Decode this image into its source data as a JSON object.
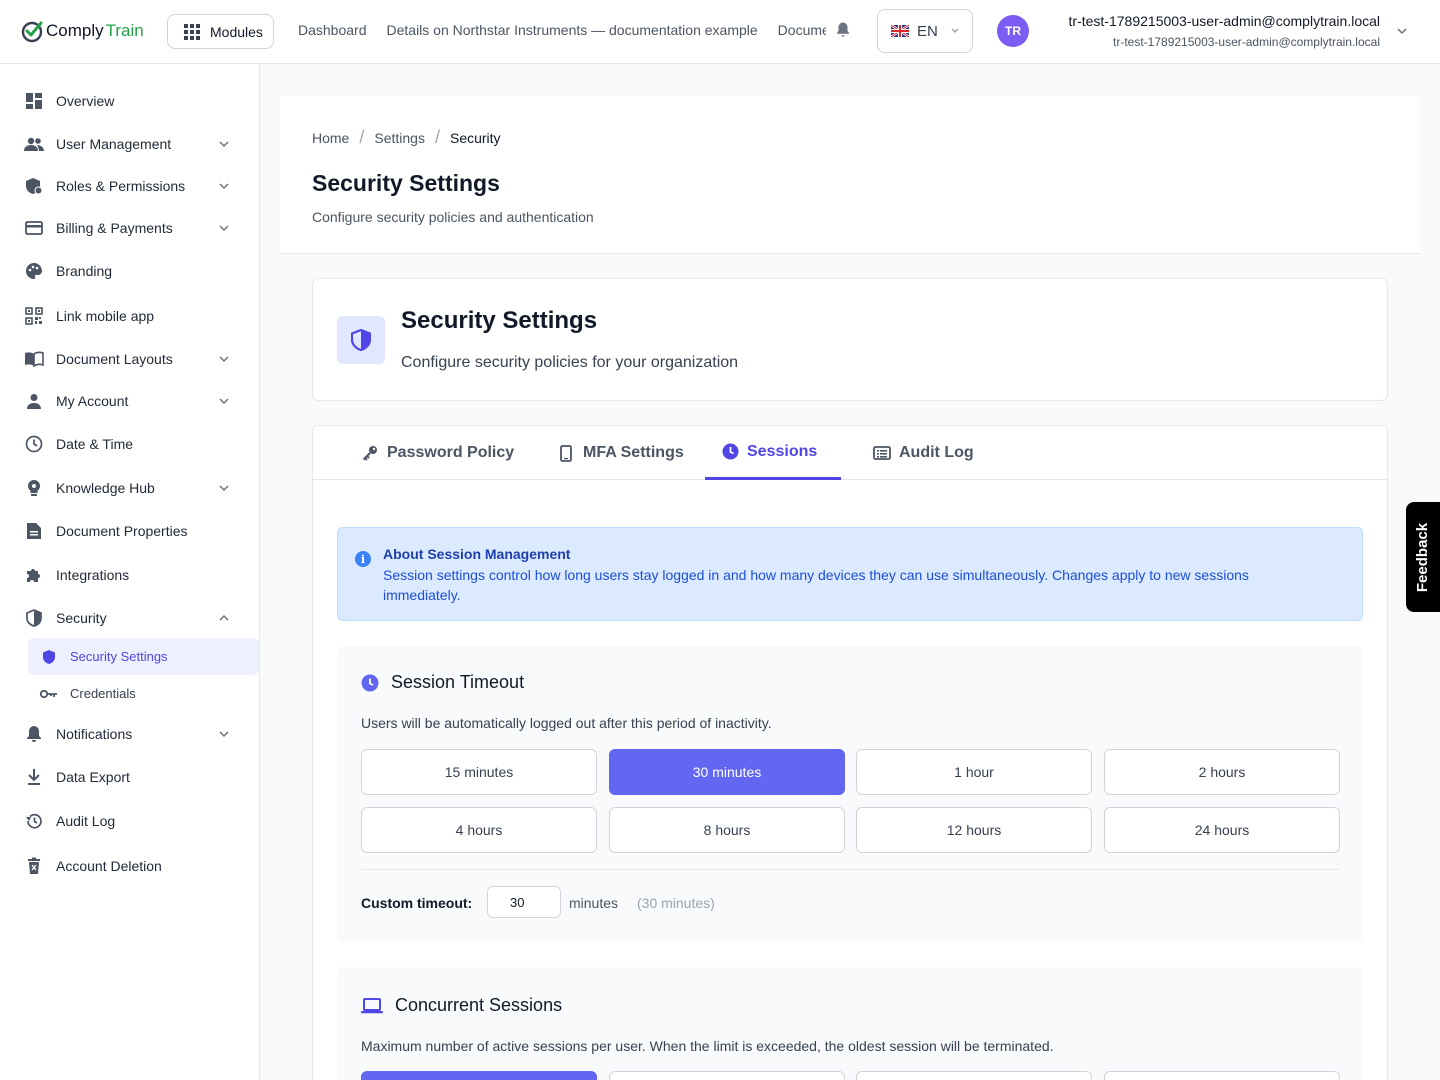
{
  "header": {
    "logo_part1": "Comply",
    "logo_part2": "Train",
    "modules_label": "Modules",
    "nav": [
      "Dashboard",
      "Details on Northstar Instruments — documentation example",
      "Documentation"
    ],
    "language": "EN",
    "avatar_initials": "TR",
    "user_name": "tr-test-1789215003-user-admin@complytrain.local",
    "user_email": "tr-test-1789215003-user-admin@complytrain.local"
  },
  "sidebar": {
    "items": [
      {
        "label": "Overview",
        "icon": "dashboard-icon"
      },
      {
        "label": "User Management",
        "icon": "users-icon"
      },
      {
        "label": "Roles & Permissions",
        "icon": "shield-user-icon"
      },
      {
        "label": "Billing & Payments",
        "icon": "credit-card-icon"
      },
      {
        "label": "Branding",
        "icon": "palette-icon"
      },
      {
        "label": "Link mobile app",
        "icon": "qr-code-icon"
      },
      {
        "label": "Document Layouts",
        "icon": "book-icon"
      },
      {
        "label": "My Account",
        "icon": "person-icon"
      },
      {
        "label": "Date & Time",
        "icon": "clock-icon"
      },
      {
        "label": "Knowledge Hub",
        "icon": "lightbulb-icon"
      },
      {
        "label": "Document Properties",
        "icon": "document-icon"
      },
      {
        "label": "Integrations",
        "icon": "puzzle-icon"
      },
      {
        "label": "Security",
        "icon": "shield-icon"
      },
      {
        "label": "Notifications",
        "icon": "bell-icon"
      },
      {
        "label": "Data Export",
        "icon": "download-icon"
      },
      {
        "label": "Audit Log",
        "icon": "history-icon"
      },
      {
        "label": "Account Deletion",
        "icon": "trash-icon"
      }
    ],
    "security_sub": [
      {
        "label": "Security Settings",
        "icon": "shield-icon"
      },
      {
        "label": "Credentials",
        "icon": "key-icon"
      }
    ]
  },
  "page": {
    "breadcrumb": [
      "Home",
      "Settings",
      "Security"
    ],
    "title": "Security Settings",
    "subtitle": "Configure security policies and authentication"
  },
  "hero": {
    "title": "Security Settings",
    "subtitle": "Configure security policies for your organization"
  },
  "tabs": [
    {
      "label": "Password Policy",
      "icon": "key-icon"
    },
    {
      "label": "MFA Settings",
      "icon": "phone-icon"
    },
    {
      "label": "Sessions",
      "icon": "clock-icon"
    },
    {
      "label": "Audit Log",
      "icon": "list-icon"
    }
  ],
  "active_tab": "Sessions",
  "info": {
    "title": "About Session Management",
    "text": "Session settings control how long users stay logged in and how many devices they can use simultaneously. Changes apply to new sessions immediately."
  },
  "session_timeout": {
    "title": "Session Timeout",
    "description": "Users will be automatically logged out after this period of inactivity.",
    "options": [
      "15 minutes",
      "30 minutes",
      "1 hour",
      "2 hours",
      "4 hours",
      "8 hours",
      "12 hours",
      "24 hours"
    ],
    "selected": "30 minutes",
    "custom_label": "Custom timeout:",
    "custom_value": "30",
    "custom_unit": "minutes",
    "custom_hint": "(30 minutes)"
  },
  "concurrent_sessions": {
    "title": "Concurrent Sessions",
    "description": "Maximum number of active sessions per user. When the limit is exceeded, the oldest session will be terminated."
  },
  "feedback_label": "Feedback",
  "colors": {
    "accent": "#6366f1",
    "brand_green": "#22a34a",
    "info_bg": "#dbeafe"
  }
}
